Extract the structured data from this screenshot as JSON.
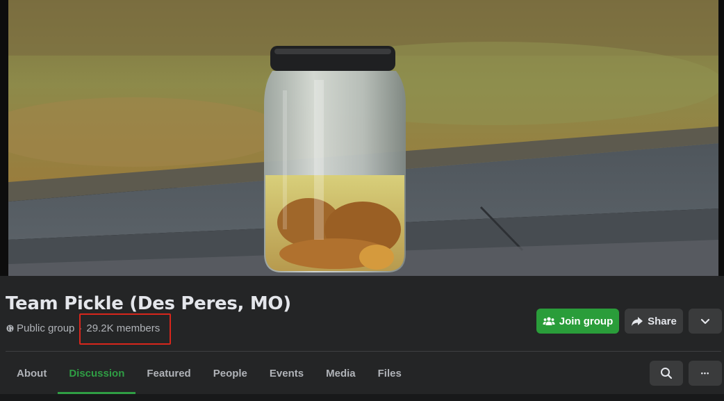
{
  "group": {
    "name": "Team Pickle (Des Peres, MO)",
    "privacy": "Public group",
    "separator": "·",
    "members": "29.2K members"
  },
  "actions": {
    "join_label": "Join group",
    "share_label": "Share",
    "more_icon": "chevron-down-icon"
  },
  "tabs": [
    {
      "label": "About",
      "active": false
    },
    {
      "label": "Discussion",
      "active": true
    },
    {
      "label": "Featured",
      "active": false
    },
    {
      "label": "People",
      "active": false
    },
    {
      "label": "Events",
      "active": false
    },
    {
      "label": "Media",
      "active": false
    },
    {
      "label": "Files",
      "active": false
    }
  ],
  "toolbar": {
    "search_icon": "search-icon",
    "more_icon": "ellipsis-icon",
    "more_glyph": "•••"
  },
  "colors": {
    "accent_green": "#2f9e44",
    "join_button": "#2a9d3a",
    "highlight_red": "#d9261c",
    "background": "#242526"
  }
}
